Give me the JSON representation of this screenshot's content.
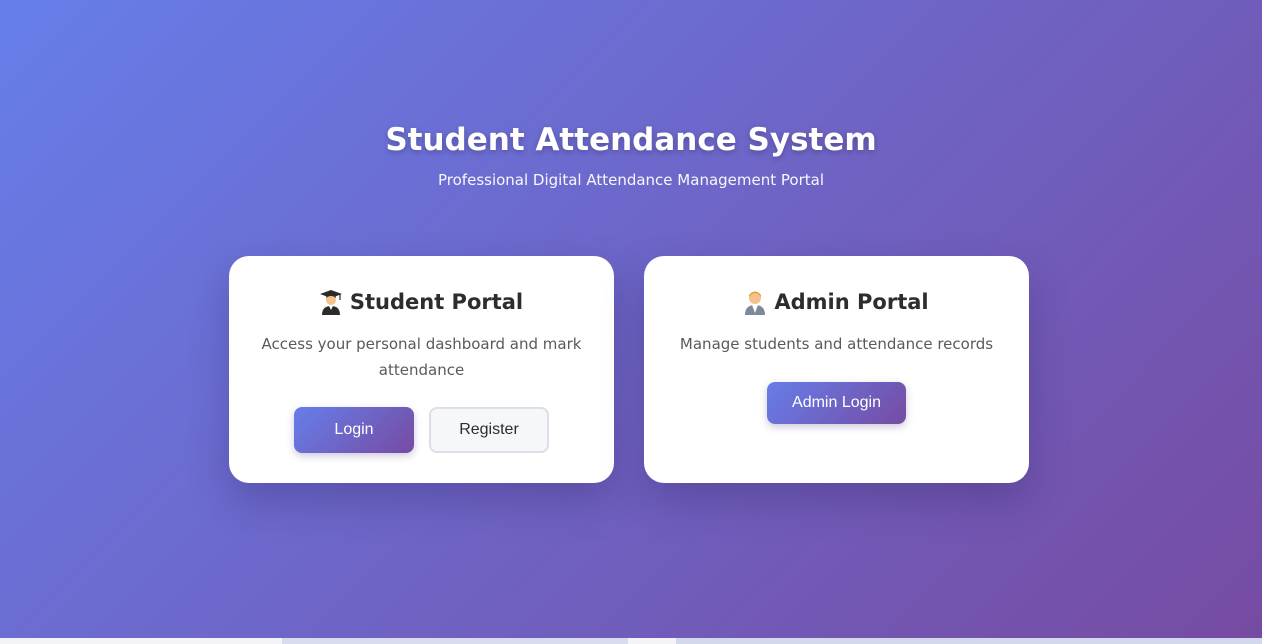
{
  "header": {
    "title": "Student Attendance System",
    "subtitle": "Professional Digital Attendance Management Portal"
  },
  "student_portal": {
    "icon": "student-graduate-icon",
    "title": "Student Portal",
    "description": "Access your personal dashboard and mark attendance",
    "login_label": "Login",
    "register_label": "Register"
  },
  "admin_portal": {
    "icon": "admin-person-icon",
    "title": "Admin Portal",
    "description": "Manage students and attendance records",
    "login_label": "Admin Login"
  },
  "colors": {
    "gradient_start": "#667eea",
    "gradient_end": "#764ba2",
    "card_bg": "#ffffff"
  }
}
